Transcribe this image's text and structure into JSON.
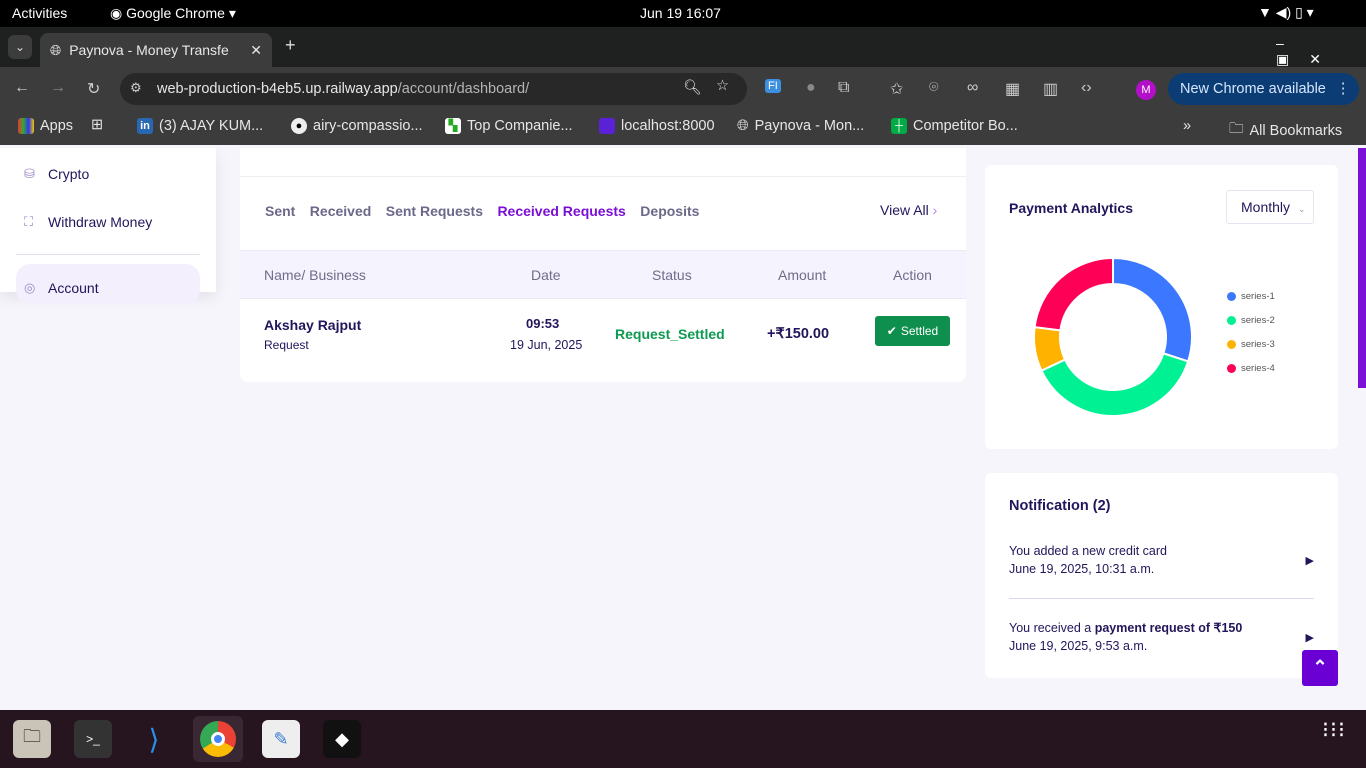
{
  "system": {
    "activities": "Activities",
    "app_name": "Google Chrome",
    "datetime": "Jun 19  16:07"
  },
  "browser": {
    "tab_title": "Paynova - Money Transfe",
    "url_host": "web-production-b4eb5.up.railway.app",
    "url_path": "/account/dashboard/",
    "profile_initial": "M",
    "update_label": "New Chrome available",
    "bookmarks": [
      "Apps",
      "(3) AJAY KUM...",
      "airy-compassio...",
      "Top Companie...",
      "localhost:8000",
      "Paynova - Mon...",
      "Competitor Bo..."
    ],
    "all_bookmarks": "All Bookmarks"
  },
  "sidebar": {
    "items": [
      {
        "label": "Crypto"
      },
      {
        "label": "Withdraw Money"
      },
      {
        "label": "Account"
      }
    ]
  },
  "transactions": {
    "tabs": [
      "Sent",
      "Received",
      "Sent Requests",
      "Received Requests",
      "Deposits"
    ],
    "active_tab": "Received Requests",
    "view_all": "View All",
    "columns": [
      "Name/ Business",
      "Date",
      "Status",
      "Amount",
      "Action"
    ],
    "rows": [
      {
        "name": "Akshay Rajput",
        "type": "Request",
        "time": "09:53",
        "date": "19 Jun, 2025",
        "status": "Request_Settled",
        "amount": "+₹150.00",
        "action": "Settled"
      }
    ]
  },
  "analytics": {
    "title": "Payment Analytics",
    "period": "Monthly"
  },
  "chart_data": {
    "type": "pie",
    "variant": "donut",
    "labels": [
      "series-1",
      "series-2",
      "series-3",
      "series-4"
    ],
    "values": [
      30,
      38,
      9,
      23
    ],
    "colors": [
      "#3b78ff",
      "#00f094",
      "#ffb200",
      "#ff0057"
    ],
    "legend": "right"
  },
  "notifications": {
    "title": "Notification (2)",
    "items": [
      {
        "pre": "You added a new credit card",
        "bold": "",
        "post": "",
        "time": "June 19, 2025, 10:31 a.m."
      },
      {
        "pre": "You received a ",
        "bold": "payment request",
        "post": " of ₹150",
        "time": "June 19, 2025, 9:53 a.m."
      }
    ]
  }
}
